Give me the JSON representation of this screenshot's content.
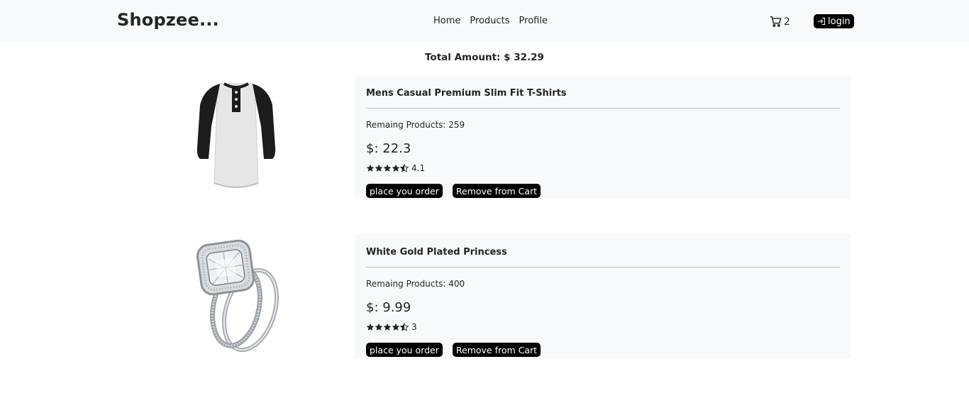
{
  "navbar": {
    "brand": "Shopzee...",
    "links": [
      "Home",
      "Products",
      "Profile"
    ],
    "cart_count": "2",
    "login_label": "login"
  },
  "total": "Total Amount: $ 32.29",
  "products": [
    {
      "title": "Mens Casual Premium Slim Fit T-Shirts",
      "stock": "Remaing Products: 259",
      "price": "$: 22.3",
      "rating": "4.1",
      "rating_value": 4.1,
      "order_label": "place you order",
      "remove_label": "Remove from Cart",
      "image_icon": "raglan-tshirt-image"
    },
    {
      "title": "White Gold Plated Princess",
      "stock": "Remaing Products: 400",
      "price": "$: 9.99",
      "rating": "3",
      "rating_value": 3,
      "order_label": "place you order",
      "remove_label": "Remove from Cart",
      "image_icon": "diamond-ring-image"
    }
  ],
  "colors": {
    "navbar_bg": "#f8f9fa",
    "card_bg": "#f8f9fa",
    "button_bg": "#000000",
    "button_text": "#ffffff"
  }
}
